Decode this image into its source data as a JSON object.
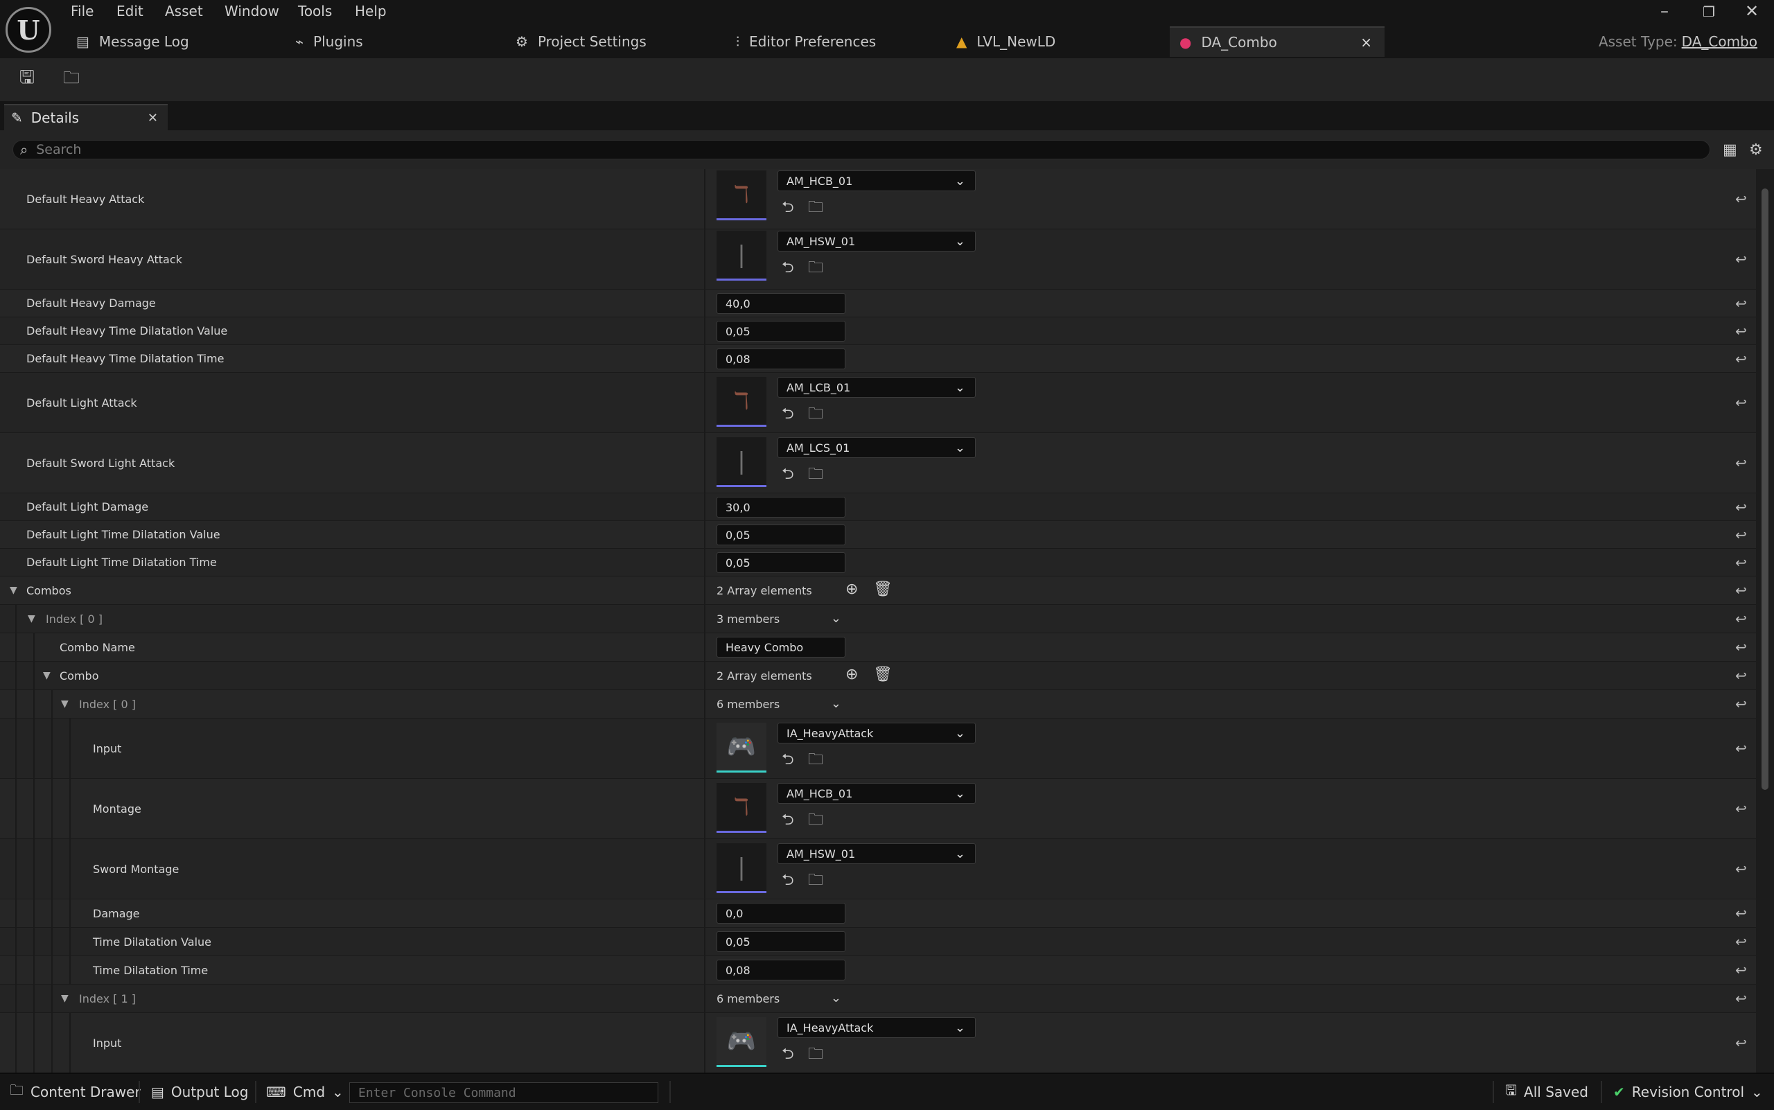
{
  "menu": {
    "file": "File",
    "edit": "Edit",
    "asset": "Asset",
    "window": "Window",
    "tools": "Tools",
    "help": "Help"
  },
  "tabs": {
    "message_log": "Message Log",
    "plugins": "Plugins",
    "project_settings": "Project Settings",
    "editor_preferences": "Editor Preferences",
    "level": "LVL_NewLD",
    "active": "DA_Combo"
  },
  "asset_type": {
    "label": "Asset Type:",
    "value": "DA_Combo"
  },
  "details": {
    "tab_label": "Details",
    "search_placeholder": "Search"
  },
  "properties": {
    "default_heavy_attack": {
      "label": "Default Heavy Attack",
      "value": "AM_HCB_01"
    },
    "default_sword_heavy_attack": {
      "label": "Default Sword Heavy Attack",
      "value": "AM_HSW_01"
    },
    "default_heavy_damage": {
      "label": "Default Heavy Damage",
      "value": "40,0"
    },
    "default_heavy_td_value": {
      "label": "Default Heavy Time Dilatation Value",
      "value": "0,05"
    },
    "default_heavy_td_time": {
      "label": "Default Heavy Time Dilatation Time",
      "value": "0,08"
    },
    "default_light_attack": {
      "label": "Default Light Attack",
      "value": "AM_LCB_01"
    },
    "default_sword_light_attack": {
      "label": "Default Sword Light Attack",
      "value": "AM_LCS_01"
    },
    "default_light_damage": {
      "label": "Default Light Damage",
      "value": "30,0"
    },
    "default_light_td_value": {
      "label": "Default Light Time Dilatation Value",
      "value": "0,05"
    },
    "default_light_td_time": {
      "label": "Default Light Time Dilatation Time",
      "value": "0,05"
    },
    "combos": {
      "label": "Combos",
      "value": "2 Array elements"
    },
    "combos_index0": {
      "label": "Index [ 0 ]",
      "value": "3 members"
    },
    "combo_name": {
      "label": "Combo Name",
      "value": "Heavy Combo"
    },
    "combo": {
      "label": "Combo",
      "value": "2 Array elements"
    },
    "combo_index0": {
      "label": "Index [ 0 ]",
      "value": "6 members"
    },
    "input0": {
      "label": "Input",
      "value": "IA_HeavyAttack"
    },
    "montage0": {
      "label": "Montage",
      "value": "AM_HCB_01"
    },
    "sword_montage0": {
      "label": "Sword Montage",
      "value": "AM_HSW_01"
    },
    "damage0": {
      "label": "Damage",
      "value": "0,0"
    },
    "td_value0": {
      "label": "Time Dilatation Value",
      "value": "0,05"
    },
    "td_time0": {
      "label": "Time Dilatation Time",
      "value": "0,08"
    },
    "combo_index1": {
      "label": "Index [ 1 ]",
      "value": "6 members"
    },
    "input1": {
      "label": "Input",
      "value": "IA_HeavyAttack"
    }
  },
  "statusbar": {
    "content_drawer": "Content Drawer",
    "output_log": "Output Log",
    "cmd": "Cmd",
    "console_placeholder": "Enter Console Command",
    "all_saved": "All Saved",
    "revision_control": "Revision Control"
  },
  "colors": {
    "anim_accent": "#6a6ae0",
    "input_accent": "#3ad1c8",
    "asset_tab_icon": "#e0356a"
  }
}
